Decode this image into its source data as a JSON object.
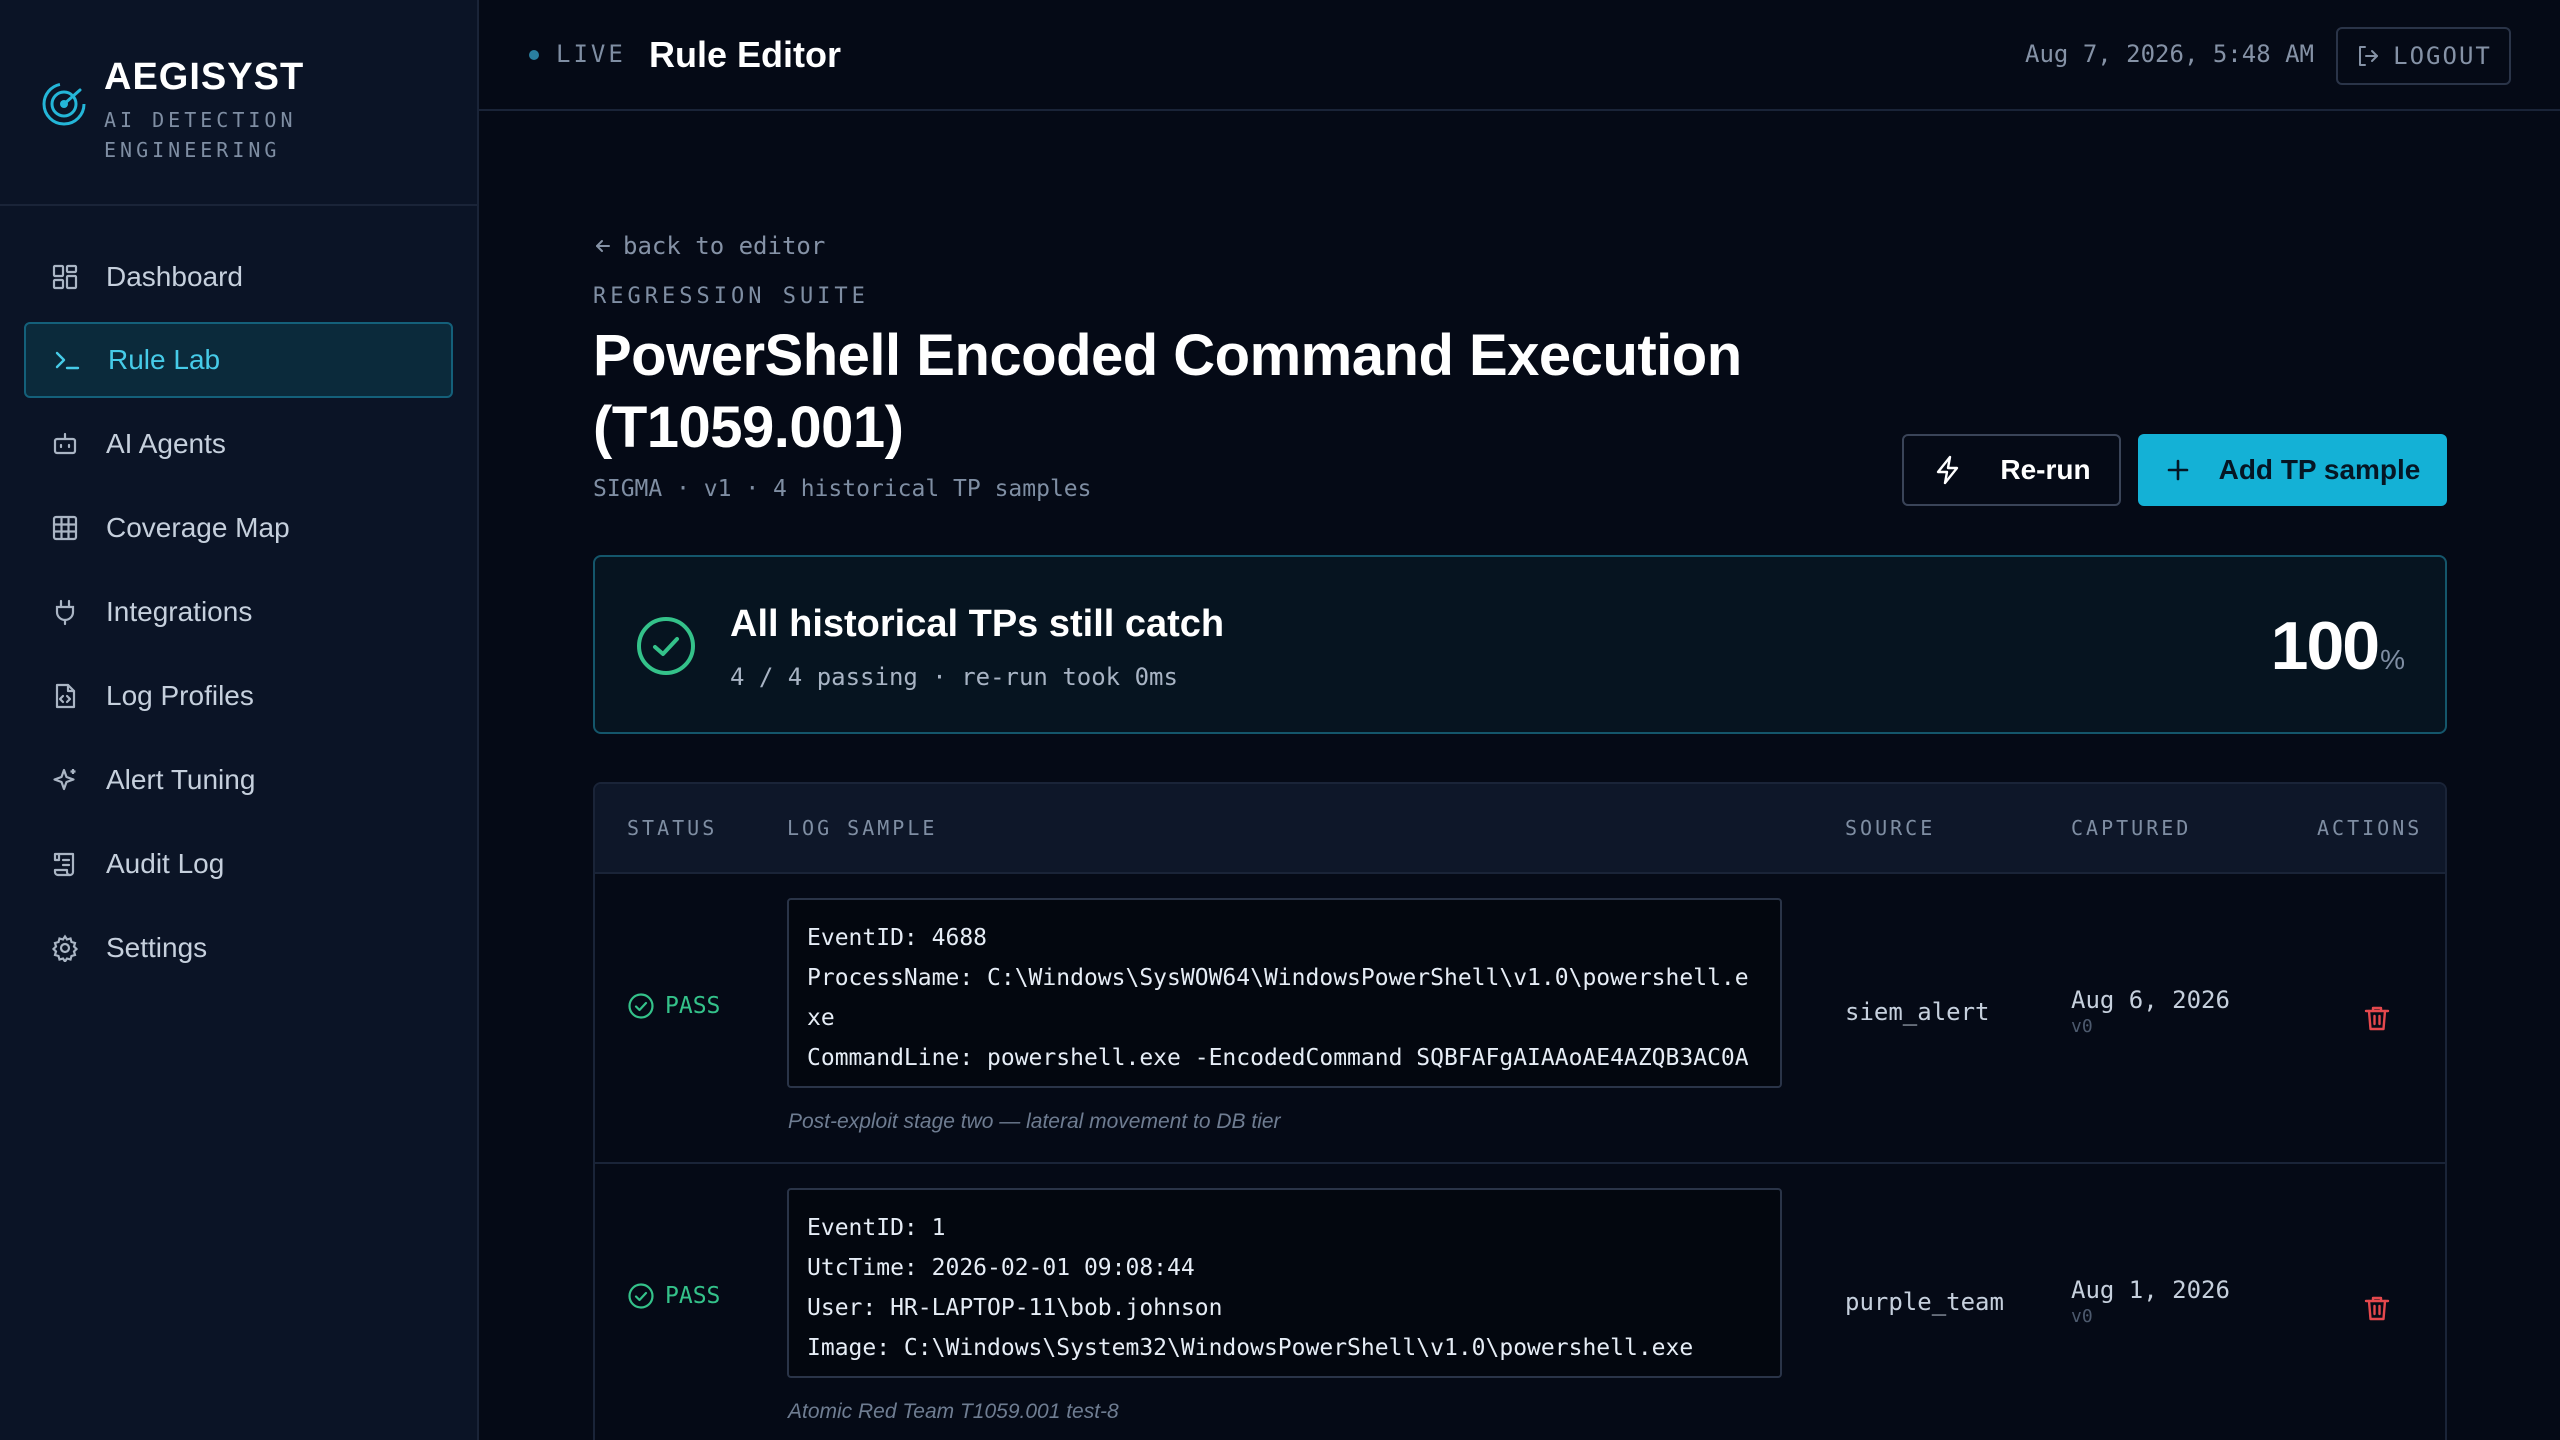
{
  "brand": {
    "name": "AEGISYST",
    "subtitle": "AI DETECTION ENGINEERING"
  },
  "sidebar": {
    "items": [
      {
        "label": "Dashboard",
        "icon": "dashboard-icon"
      },
      {
        "label": "Rule Lab",
        "icon": "terminal-icon",
        "active": true
      },
      {
        "label": "AI Agents",
        "icon": "bot-icon"
      },
      {
        "label": "Coverage Map",
        "icon": "grid-icon"
      },
      {
        "label": "Integrations",
        "icon": "plug-icon"
      },
      {
        "label": "Log Profiles",
        "icon": "file-code-icon"
      },
      {
        "label": "Alert Tuning",
        "icon": "sparkles-icon"
      },
      {
        "label": "Audit Log",
        "icon": "scroll-icon"
      },
      {
        "label": "Settings",
        "icon": "gear-icon"
      }
    ]
  },
  "topbar": {
    "live": "LIVE",
    "title": "Rule Editor",
    "datetime": "Aug 7, 2026, 5:48 AM",
    "logout": "LOGOUT"
  },
  "main": {
    "back": "back to editor",
    "suite": "REGRESSION SUITE",
    "title": "PowerShell Encoded Command Execution (T1059.001)",
    "meta": "SIGMA · v1 · 4 historical TP samples",
    "rerun_label": "Re-run",
    "add_label": "Add TP sample"
  },
  "result": {
    "title": "All historical TPs still catch",
    "summary": "4 / 4 passing · re-run took 0ms",
    "percent": "100",
    "unit": "%"
  },
  "table": {
    "columns": {
      "status": "STATUS",
      "log": "LOG SAMPLE",
      "source": "SOURCE",
      "captured": "CAPTURED",
      "actions": "ACTIONS"
    },
    "rows": [
      {
        "status": "PASS",
        "log": "EventID: 4688\nProcessName: C:\\Windows\\SysWOW64\\WindowsPowerShell\\v1.0\\powershell.exe\nCommandLine: powershell.exe -EncodedCommand SQBFAFgAIAAoAE4AZQB3AC0A",
        "note": "Post-exploit stage two — lateral movement to DB tier",
        "source": "siem_alert",
        "captured": "Aug 6, 2026",
        "version": "v0"
      },
      {
        "status": "PASS",
        "log": "EventID: 1\nUtcTime: 2026-02-01 09:08:44\nUser: HR-LAPTOP-11\\bob.johnson\nImage: C:\\Windows\\System32\\WindowsPowerShell\\v1.0\\powershell.exe",
        "note": "Atomic Red Team T1059.001 test-8",
        "source": "purple_team",
        "captured": "Aug 1, 2026",
        "version": "v0"
      }
    ]
  },
  "colors": {
    "accent": "#14b1d6",
    "pass": "#34c28a",
    "danger": "#e5484d",
    "background": "#050a16"
  }
}
